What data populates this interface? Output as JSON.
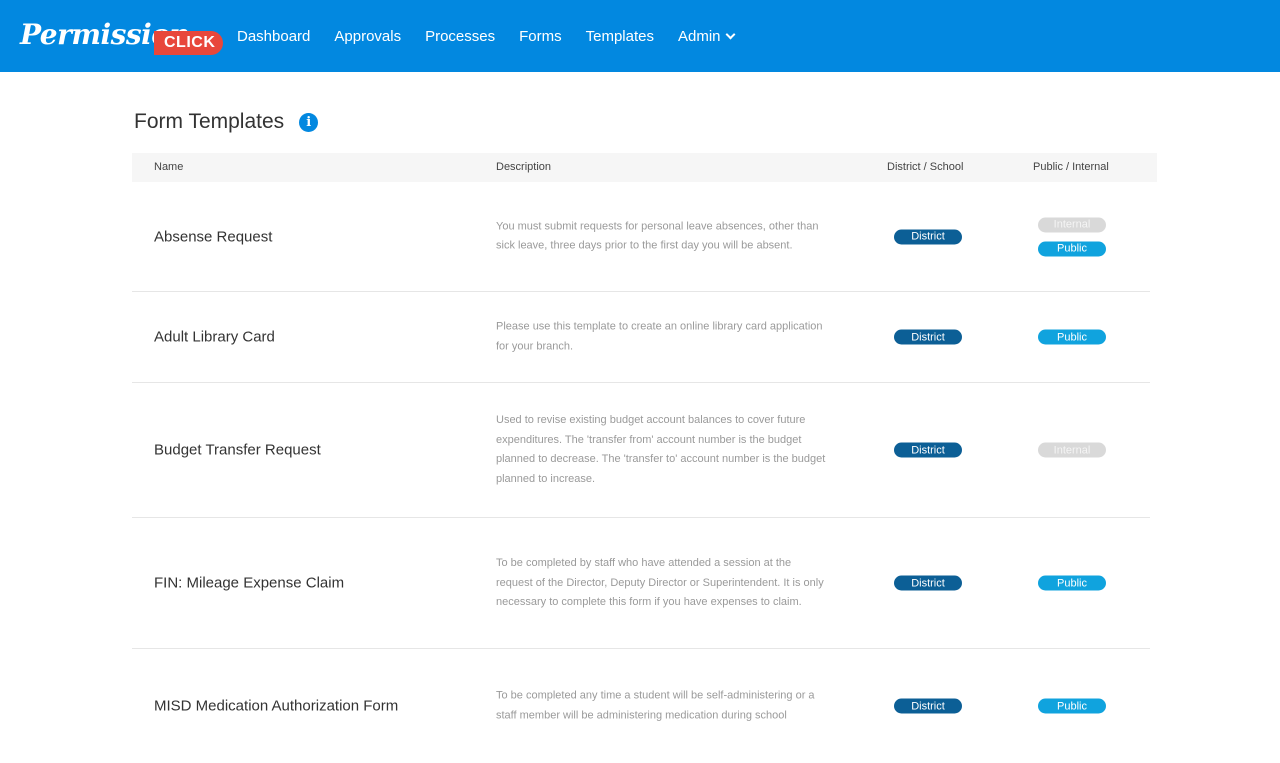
{
  "brand": {
    "word": "Permission",
    "click": "CLICK"
  },
  "nav": {
    "items": [
      "Dashboard",
      "Approvals",
      "Processes",
      "Forms",
      "Templates"
    ],
    "admin": "Admin"
  },
  "page": {
    "title": "Form Templates"
  },
  "table": {
    "headers": {
      "name": "Name",
      "description": "Description",
      "scope": "District / School",
      "visibility": "Public / Internal"
    },
    "rows": [
      {
        "name": "Absense Request",
        "description": "You must submit requests for personal leave absences, other than sick leave, three days prior to the first day you will be absent.",
        "scope": "District",
        "visibility": [
          "Internal",
          "Public"
        ]
      },
      {
        "name": "Adult Library Card",
        "description": "Please use this template to create an online library card application for your branch.",
        "scope": "District",
        "visibility": [
          "Public"
        ]
      },
      {
        "name": "Budget Transfer Request",
        "description": "Used to revise existing budget account balances to cover future expenditures. The 'transfer from' account number is the budget planned to decrease. The 'transfer to' account number is the budget planned to increase.",
        "scope": "District",
        "visibility": [
          "Internal"
        ]
      },
      {
        "name": "FIN: Mileage Expense Claim",
        "description": "To be completed by staff who have attended a session at the request of the Director, Deputy Director or Superintendent. It is only necessary to complete this form if you have expenses to claim.",
        "scope": "District",
        "visibility": [
          "Public"
        ]
      },
      {
        "name": "MISD Medication Authorization Form",
        "description": "To be completed any time a student will be self-administering or a staff member will be administering medication during school",
        "scope": "District",
        "visibility": [
          "Public"
        ]
      }
    ]
  },
  "colors": {
    "topbar": "#0288e0",
    "district_badge": "#0c5f96",
    "public_badge": "#10a3de",
    "internal_badge": "#d9d9d9",
    "click_badge": "#e8473b"
  }
}
